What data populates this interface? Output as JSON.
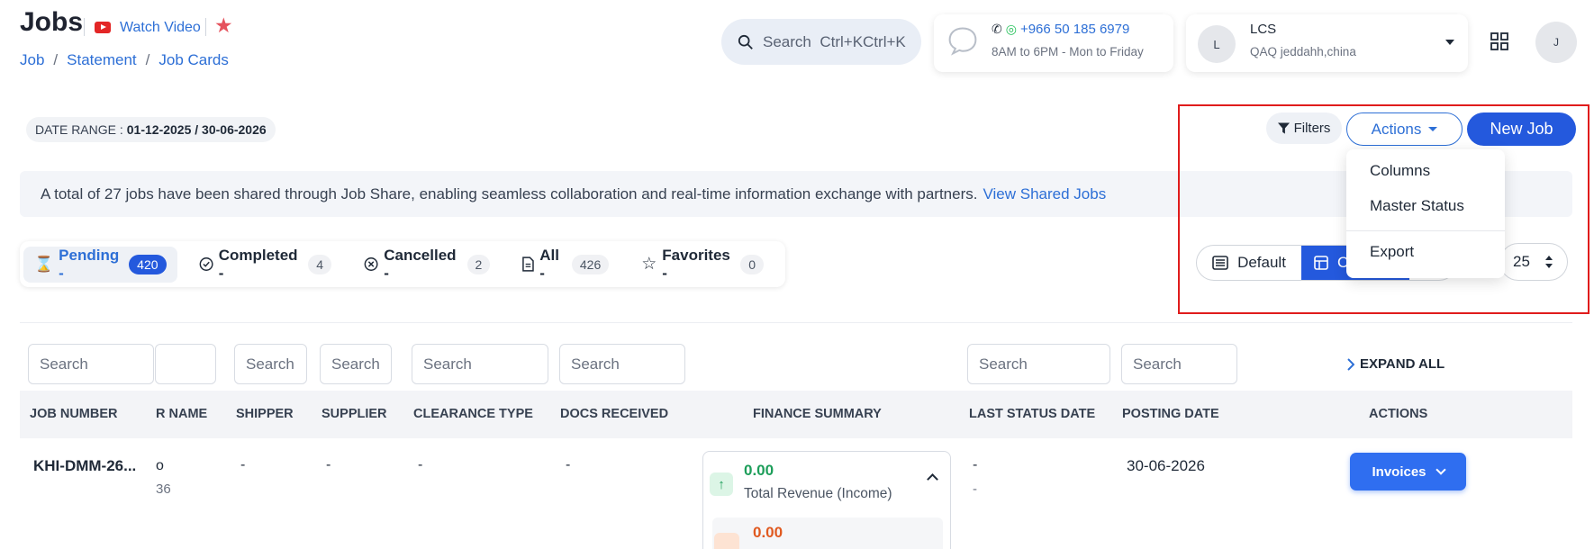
{
  "header": {
    "title": "Jobs",
    "watch_video": "Watch Video",
    "breadcrumb": [
      "Job",
      "Statement",
      "Job Cards"
    ]
  },
  "search": {
    "label": "Search",
    "shortcut": "Ctrl+KCtrl+K"
  },
  "contact": {
    "phone": "+966 50 185 6979",
    "hours": "8AM to 6PM - Mon to Friday"
  },
  "company": {
    "avatar": "L",
    "name": "LCS",
    "location": "QAQ jeddahh,china"
  },
  "user": {
    "avatar": "J"
  },
  "toolbar": {
    "date_range_label": "DATE RANGE :",
    "date_range_value": "01-12-2025 / 30-06-2026",
    "filters": "Filters",
    "actions": "Actions",
    "new_job": "New Job"
  },
  "actions_menu": [
    "Columns",
    "Master Status",
    "Export"
  ],
  "banner": {
    "text": "A total of 27 jobs have been shared through Job Share, enabling seamless collaboration and real-time information exchange with partners.",
    "link": "View Shared Jobs"
  },
  "status_tabs": [
    {
      "label": "Pending -",
      "count": "420",
      "icon": "hourglass-icon",
      "active": true
    },
    {
      "label": "Completed -",
      "count": "4",
      "icon": "check-circle-icon",
      "active": false
    },
    {
      "label": "Cancelled -",
      "count": "2",
      "icon": "x-circle-icon",
      "active": false
    },
    {
      "label": "All -",
      "count": "426",
      "icon": "document-icon",
      "active": false
    },
    {
      "label": "Favorites -",
      "count": "0",
      "icon": "star-icon",
      "active": false
    }
  ],
  "view_toggle": {
    "default": "Default",
    "compact_partial": "C"
  },
  "per_page": "25",
  "table": {
    "filter_placeholder": "Search",
    "expand_all": "EXPAND ALL",
    "columns": [
      "JOB NUMBER",
      "R NAME",
      "SHIPPER",
      "SUPPLIER",
      "CLEARANCE TYPE",
      "DOCS RECEIVED",
      "FINANCE SUMMARY",
      "LAST STATUS DATE",
      "POSTING DATE",
      "ACTIONS"
    ],
    "row": {
      "job_number": "KHI-DMM-26...",
      "customer_line1": "o",
      "customer_line2": "36",
      "shipper": "-",
      "supplier": "-",
      "clearance_type": "-",
      "docs_received": "-",
      "revenue_value": "0.00",
      "revenue_label": "Total Revenue (Income)",
      "cost_value": "0.00",
      "last_status_date": "-",
      "last_status_sub": "-",
      "posting_date": "30-06-2026",
      "action": "Invoices"
    }
  },
  "colors": {
    "primary": "#2459dd",
    "link": "#2d6fd6",
    "highlight": "#e01c1c",
    "revenue": "#1d9e5a",
    "cost": "#e0591f"
  }
}
